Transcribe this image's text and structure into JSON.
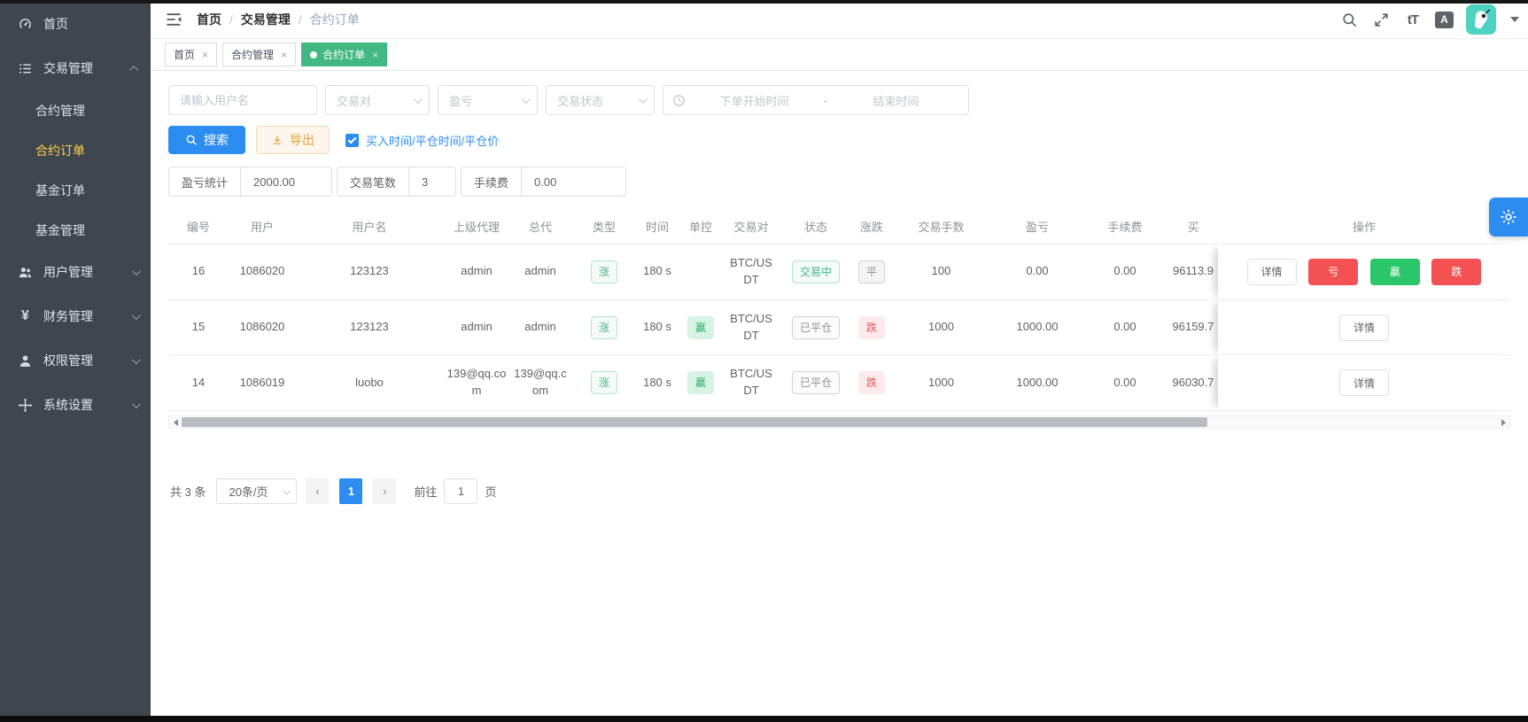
{
  "sidebar": {
    "items": [
      {
        "label": "首页",
        "icon": "dashboard-icon"
      },
      {
        "label": "交易管理",
        "icon": "trade-list-icon",
        "expanded": true,
        "children": [
          {
            "label": "合约管理"
          },
          {
            "label": "合约订单",
            "active": true
          },
          {
            "label": "基金订单"
          },
          {
            "label": "基金管理"
          }
        ]
      },
      {
        "label": "用户管理",
        "icon": "users-icon"
      },
      {
        "label": "财务管理",
        "icon": "yen-icon",
        "yen": "¥"
      },
      {
        "label": "权限管理",
        "icon": "person-icon"
      },
      {
        "label": "系统设置",
        "icon": "system-icon"
      }
    ]
  },
  "navbar": {
    "breadcrumb": {
      "home": "首页",
      "sep1": "/",
      "trade": "交易管理",
      "sep2": "/",
      "current": "合约订单"
    },
    "lang_icon_text": "A",
    "font_icon_text": "tT"
  },
  "tabs": [
    {
      "label": "首页",
      "close": "×"
    },
    {
      "label": "合约管理",
      "close": "×"
    },
    {
      "label": "合约订单",
      "close": "×",
      "active": true
    }
  ],
  "filters": {
    "username_placeholder": "请输入用户名",
    "pair_placeholder": "交易对",
    "pnl_placeholder": "盈亏",
    "status_placeholder": "交易状态",
    "date_start_placeholder": "下单开始时间",
    "date_separator": "-",
    "date_end_placeholder": "结束时间"
  },
  "actions": {
    "search_label": "搜索",
    "export_label": "导出",
    "checkbox_label": "买入时间/平仓时间/平仓价",
    "checkbox_checked": true
  },
  "stats": {
    "pnl_label": "盈亏统计",
    "pnl_value": "2000.00",
    "count_label": "交易笔数",
    "count_value": "3",
    "fee_label": "手续费",
    "fee_value": "0.00"
  },
  "table": {
    "headers": [
      "编号",
      "用户",
      "用户名",
      "上级代理",
      "总代",
      "类型",
      "时间",
      "单控",
      "交易对",
      "状态",
      "涨跌",
      "交易手数",
      "盈亏",
      "手续费",
      "买",
      "操作"
    ],
    "rows": [
      {
        "id": "16",
        "user": "1086020",
        "username": "123123",
        "agent": "admin",
        "general_agent": "admin",
        "type": "涨",
        "duration": "180 s",
        "control": "",
        "pair": "BTC/USDT",
        "status": "交易中",
        "updown": "平",
        "lots": "100",
        "profit": "0.00",
        "fee": "0.00",
        "buy_price": "96113.9",
        "actions": {
          "detail": "详情",
          "loss": "亏",
          "win": "赢",
          "fall": "跌"
        }
      },
      {
        "id": "15",
        "user": "1086020",
        "username": "123123",
        "agent": "admin",
        "general_agent": "admin",
        "type": "涨",
        "duration": "180 s",
        "control": "赢",
        "pair": "BTC/USDT",
        "status": "已平仓",
        "updown": "跌",
        "lots": "1000",
        "profit": "1000.00",
        "fee": "0.00",
        "buy_price": "96159.7",
        "actions": {
          "detail": "详情"
        }
      },
      {
        "id": "14",
        "user": "1086019",
        "username": "luobo",
        "agent": "139@qq.com",
        "general_agent": "139@qq.com",
        "type": "涨",
        "duration": "180 s",
        "control": "赢",
        "pair": "BTC/USDT",
        "status": "已平仓",
        "updown": "跌",
        "lots": "1000",
        "profit": "1000.00",
        "fee": "0.00",
        "buy_price": "96030.7",
        "actions": {
          "detail": "详情"
        }
      }
    ]
  },
  "pagination": {
    "total": "共 3 条",
    "page_size": "20条/页",
    "current_page": "1",
    "goto_label": "前往",
    "goto_value": "1",
    "page_unit": "页"
  },
  "colors": {
    "primary": "#2d8cf0",
    "tab_active": "#42b983",
    "danger": "#f45252",
    "success": "#2bc56a",
    "warning": "#e6a23c",
    "sidebar_bg": "#3f4650",
    "active_menu": "#ffd04b"
  }
}
